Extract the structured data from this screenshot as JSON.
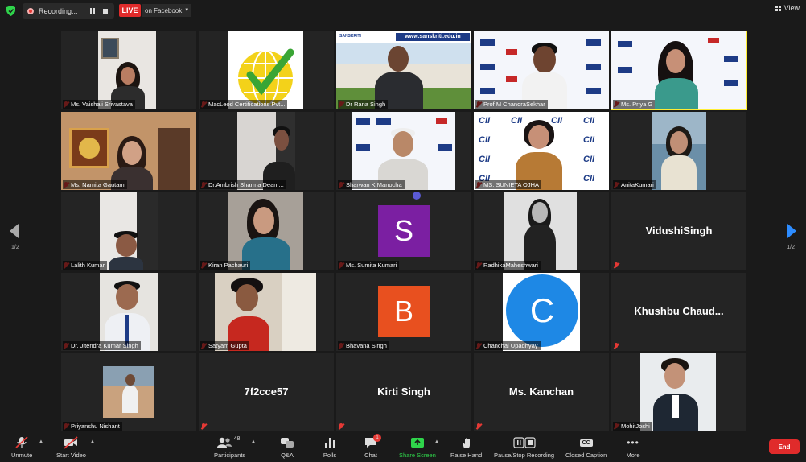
{
  "top": {
    "recording_label": "Recording...",
    "live_label": "LIVE",
    "live_target": "on Facebook",
    "view_label": "View"
  },
  "pager": {
    "left": "1/2",
    "right": "1/2"
  },
  "colors": {
    "active_speaker_border": "#ffee35",
    "end_button": "#e02b2b",
    "share_screen": "#2fd44b",
    "live_badge": "#e02b2b"
  },
  "participants": [
    {
      "name": "Ms. Vaishali Srivastava",
      "type": "video"
    },
    {
      "name": "MacLeod Certifications Pvt...",
      "type": "video"
    },
    {
      "name": "Dr Rana Singh",
      "type": "video"
    },
    {
      "name": "Prof M ChandraSekhar",
      "type": "video"
    },
    {
      "name": "Ms. Priya G",
      "type": "video",
      "active": true
    },
    {
      "name": "Ms. Namita Gautam",
      "type": "video"
    },
    {
      "name": "Dr.Ambrish Sharma Dean ...",
      "type": "video"
    },
    {
      "name": "Sharwan K Manocha",
      "type": "video"
    },
    {
      "name": "MS. SUNIETA OJHA",
      "type": "video"
    },
    {
      "name": "AnitaKumari",
      "type": "video"
    },
    {
      "name": "Lalith Kumar",
      "type": "video"
    },
    {
      "name": "Kiran Pachauri",
      "type": "video"
    },
    {
      "name": "Ms. Sumita Kumari",
      "type": "avatar",
      "letter": "S",
      "color": "#7b1fa2"
    },
    {
      "name": "RadhikaMaheshwari",
      "type": "video"
    },
    {
      "name": "",
      "type": "text",
      "display": "VidushiSingh"
    },
    {
      "name": "Dr. Jitendra Kumar Singh",
      "type": "video"
    },
    {
      "name": "Satyam Gupta",
      "type": "video"
    },
    {
      "name": "Bhavana Singh",
      "type": "avatar",
      "letter": "B",
      "color": "#e8501f"
    },
    {
      "name": "Chanchal Upadhyay",
      "type": "avatar",
      "letter": "C",
      "color": "#1e88e5",
      "round": true
    },
    {
      "name": "",
      "type": "text",
      "display": "Khushbu  Chaud..."
    },
    {
      "name": "Priyanshu Nishant",
      "type": "video"
    },
    {
      "name": "",
      "type": "text",
      "display": "7f2cce57"
    },
    {
      "name": "",
      "type": "text",
      "display": "Kirti Singh"
    },
    {
      "name": "",
      "type": "text",
      "display": "Ms. Kanchan"
    },
    {
      "name": "MohitJoshi",
      "type": "video"
    }
  ],
  "banner": {
    "url": "www.sanskriti.edu.in",
    "org": "SANSKRITI",
    "cii": "CII",
    "macleod": "MacLeod"
  },
  "toolbar": {
    "unmute": "Unmute",
    "start_video": "Start Video",
    "participants": "Participants",
    "participants_count": "48",
    "qa": "Q&A",
    "polls": "Polls",
    "chat": "Chat",
    "chat_badge": "1",
    "share_screen": "Share Screen",
    "raise_hand": "Raise Hand",
    "pause_recording": "Pause/Stop Recording",
    "closed_caption": "Closed Caption",
    "closed_caption_icon": "CC",
    "more": "More",
    "end": "End"
  }
}
